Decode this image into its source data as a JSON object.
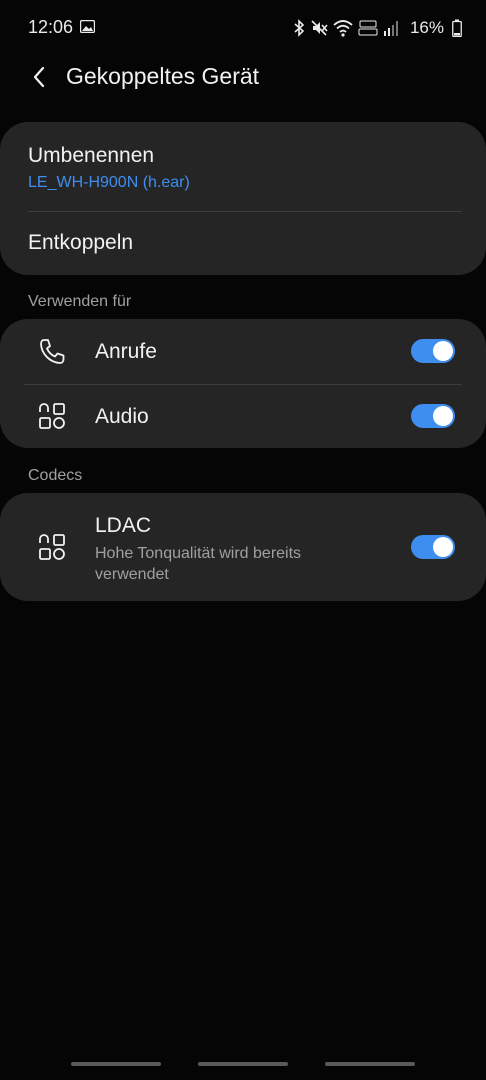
{
  "status_bar": {
    "time": "12:06",
    "battery_percent": "16%",
    "icons": [
      "gallery-icon",
      "bluetooth-icon",
      "mute-icon",
      "wifi-icon",
      "volte-icon",
      "signal-icon",
      "battery-icon"
    ]
  },
  "header": {
    "back_icon": "chevron-left-icon",
    "title": "Gekoppeltes Gerät"
  },
  "device_card": {
    "rename_label": "Umbenennen",
    "device_name": "LE_WH-H900N (h.ear)",
    "unpair_label": "Entkoppeln"
  },
  "use_for": {
    "section_title": "Verwenden für",
    "items": [
      {
        "label": "Anrufe",
        "icon": "phone-icon",
        "enabled": true
      },
      {
        "label": "Audio",
        "icon": "apps-icon",
        "enabled": true
      }
    ]
  },
  "codecs": {
    "section_title": "Codecs",
    "items": [
      {
        "label": "LDAC",
        "description": "Hohe Tonqualität wird bereits verwendet",
        "icon": "apps-icon",
        "enabled": true
      }
    ]
  },
  "colors": {
    "background": "#050505",
    "card": "#252525",
    "accent": "#3e8ef0",
    "secondary_text": "#a0a0a0"
  }
}
